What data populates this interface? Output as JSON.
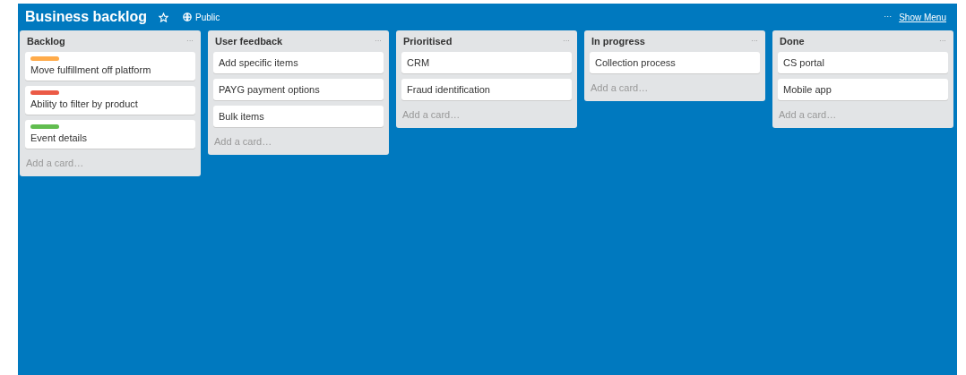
{
  "board": {
    "title": "Business backlog",
    "visibility": "Public",
    "menu_dots": "···",
    "show_menu": "Show Menu"
  },
  "lists": [
    {
      "title": "Backlog",
      "menu": "···",
      "add": "Add a card…",
      "cards": [
        {
          "text": "Move fulfillment off platform",
          "color": "#ffab4a"
        },
        {
          "text": "Ability to filter by product",
          "color": "#eb5a46"
        },
        {
          "text": "Event details",
          "color": "#61bd4f"
        }
      ]
    },
    {
      "title": "User feedback",
      "menu": "···",
      "add": "Add a card…",
      "cards": [
        {
          "text": "Add specific items"
        },
        {
          "text": "PAYG payment options"
        },
        {
          "text": "Bulk items"
        }
      ]
    },
    {
      "title": "Prioritised",
      "menu": "···",
      "add": "Add a card…",
      "cards": [
        {
          "text": "CRM"
        },
        {
          "text": "Fraud identification"
        }
      ]
    },
    {
      "title": "In progress",
      "menu": "···",
      "add": "Add a card…",
      "cards": [
        {
          "text": "Collection process"
        }
      ]
    },
    {
      "title": "Done",
      "menu": "···",
      "add": "Add a card…",
      "cards": [
        {
          "text": "CS portal"
        },
        {
          "text": "Mobile app"
        }
      ]
    }
  ]
}
